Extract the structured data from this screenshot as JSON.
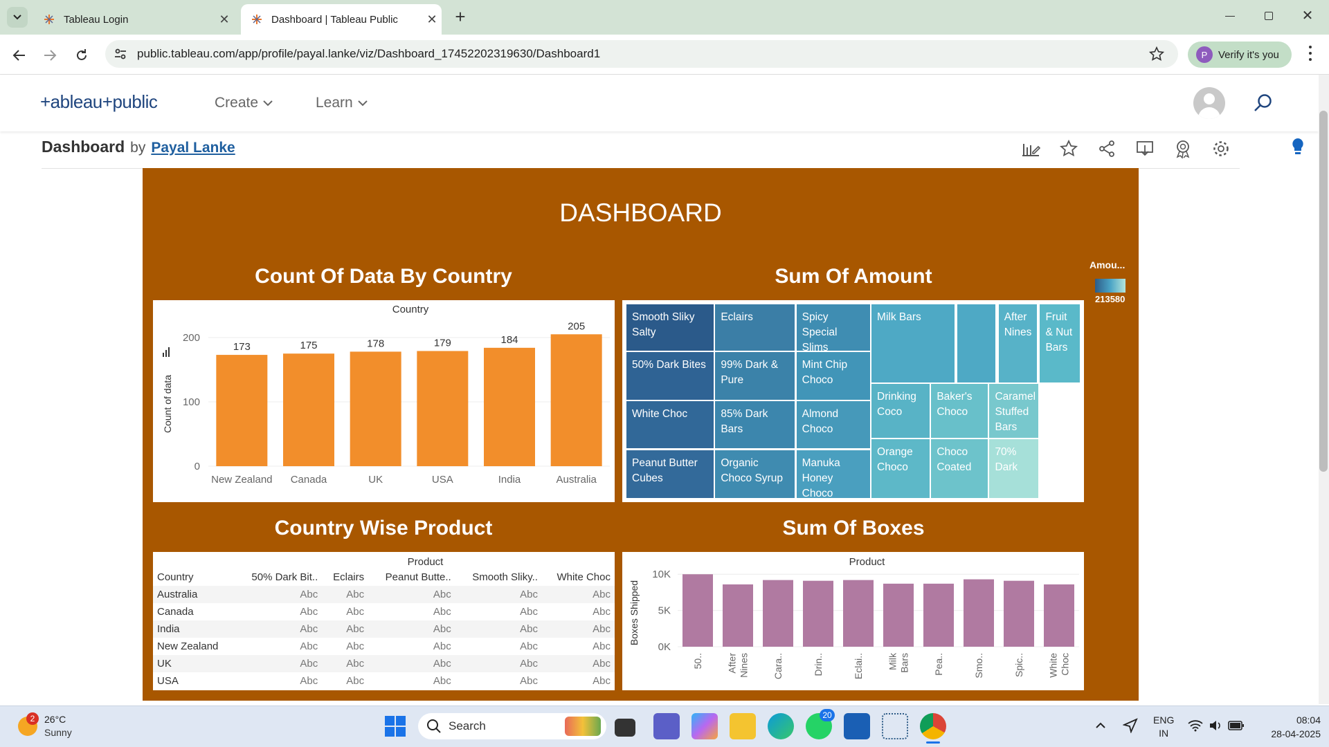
{
  "browser": {
    "tabs": [
      {
        "title": "Tableau Login"
      },
      {
        "title": "Dashboard | Tableau Public"
      }
    ],
    "url": "public.tableau.com/app/profile/payal.lanke/viz/Dashboard_17452202319630/Dashboard1",
    "verify_label": "Verify it's you",
    "profile_initial": "P"
  },
  "site": {
    "logo": "+ableau+public",
    "nav": [
      {
        "label": "Create"
      },
      {
        "label": "Learn"
      }
    ]
  },
  "viz": {
    "title": "Dashboard",
    "by": "by",
    "author": "Payal Lanke"
  },
  "dashboard": {
    "title": "DASHBOARD",
    "legend": {
      "title": "Amou...",
      "value": "213580"
    },
    "bar_panel": {
      "title": "Count Of Data By Country",
      "header": "Country"
    },
    "treemap_panel": {
      "title": "Sum Of Amount",
      "cells": [
        "Smooth Sliky Salty",
        "Eclairs",
        "Spicy Special Slims",
        "Milk Bars",
        "After Nines",
        "Fruit & Nut Bars",
        "50% Dark Bites",
        "99% Dark & Pure",
        "Mint Chip Choco",
        "White Choc",
        "85% Dark Bars",
        "Almond Choco",
        "Drinking Coco",
        "Baker's Choco",
        "Caramel Stuffed Bars",
        "Peanut Butter Cubes",
        "Organic Choco Syrup",
        "Manuka Honey Choco",
        "Orange Choco",
        "Choco Coated",
        "70% Dark"
      ]
    },
    "table_panel": {
      "title": "Country Wise Product",
      "header": "Product",
      "columns": [
        "Country",
        "50% Dark Bit..",
        "Eclairs",
        "Peanut Butte..",
        "Smooth Sliky..",
        "White Choc"
      ],
      "rows": [
        {
          "country": "Australia",
          "cells": [
            "Abc",
            "Abc",
            "Abc",
            "Abc",
            "Abc"
          ]
        },
        {
          "country": "Canada",
          "cells": [
            "Abc",
            "Abc",
            "Abc",
            "Abc",
            "Abc"
          ]
        },
        {
          "country": "India",
          "cells": [
            "Abc",
            "Abc",
            "Abc",
            "Abc",
            "Abc"
          ]
        },
        {
          "country": "New Zealand",
          "cells": [
            "Abc",
            "Abc",
            "Abc",
            "Abc",
            "Abc"
          ]
        },
        {
          "country": "UK",
          "cells": [
            "Abc",
            "Abc",
            "Abc",
            "Abc",
            "Abc"
          ]
        },
        {
          "country": "USA",
          "cells": [
            "Abc",
            "Abc",
            "Abc",
            "Abc",
            "Abc"
          ]
        }
      ]
    },
    "boxes_panel": {
      "title": "Sum Of Boxes",
      "header": "Product"
    }
  },
  "chart_data": [
    {
      "type": "bar",
      "title": "Count Of Data By Country",
      "categories": [
        "New Zealand",
        "Canada",
        "UK",
        "USA",
        "India",
        "Australia"
      ],
      "values": [
        173,
        175,
        178,
        179,
        184,
        205
      ],
      "ylabel": "Count of data",
      "yticks": [
        "0",
        "100",
        "200"
      ],
      "ylim": [
        0,
        215
      ],
      "color": "#f28e2b",
      "grid": true
    },
    {
      "type": "bar",
      "title": "Sum Of Boxes",
      "categories": [
        "50..",
        "After Nines",
        "Cara..",
        "Drin..",
        "Eclai..",
        "Milk Bars",
        "Pea..",
        "Smo..",
        "Spic..",
        "White Choc"
      ],
      "values": [
        10000,
        8600,
        9200,
        9100,
        9200,
        8700,
        8700,
        9300,
        9100,
        8600
      ],
      "ylabel": "Boxes Shipped",
      "yticks": [
        "0K",
        "5K",
        "10K"
      ],
      "ylim": [
        0,
        10500
      ],
      "color": "#b07aa1",
      "grid": true
    }
  ],
  "taskbar": {
    "weather_temp": "26°C",
    "weather_desc": "Sunny",
    "weather_badge": "2",
    "search": "Search",
    "whatsapp_badge": "20",
    "lang1": "ENG",
    "lang2": "IN",
    "time": "08:04",
    "date": "28-04-2025"
  },
  "colors": {
    "dashboard_bg": "#a85700",
    "tableau_blue": "#1f457e"
  }
}
